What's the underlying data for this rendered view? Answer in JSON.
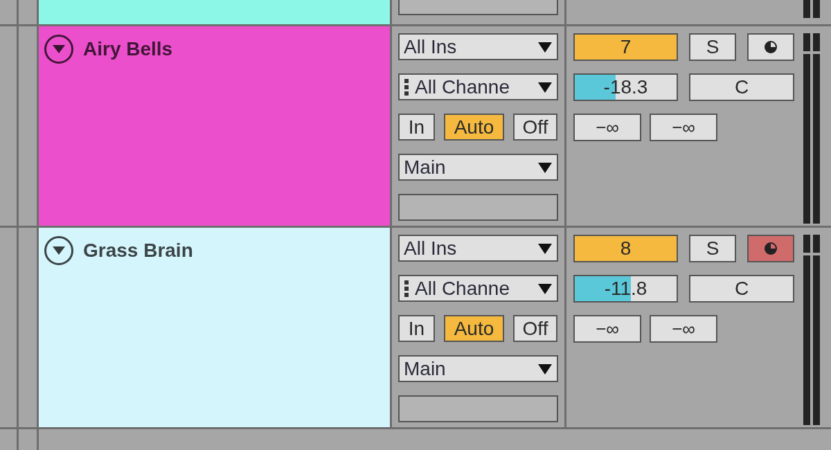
{
  "previous_track": {
    "color": "#8cf7e6"
  },
  "tracks": [
    {
      "name": "Airy Bells",
      "color": "#ec4fcb",
      "input_type": "All Ins",
      "input_channel": "All Channe",
      "monitor": [
        {
          "label": "In",
          "selected": false
        },
        {
          "label": "Auto",
          "selected": true
        },
        {
          "label": "Off",
          "selected": false
        }
      ],
      "output": "Main",
      "number": "7",
      "active": true,
      "solo": "S",
      "soloed": false,
      "armed": false,
      "volume": {
        "reading": "-18.3",
        "level": 0.4
      },
      "pan": "C",
      "sends": [
        "−∞",
        "−∞"
      ]
    },
    {
      "name": "Grass Brain",
      "color": "#d4f5fb",
      "input_type": "All Ins",
      "input_channel": "All Channe",
      "monitor": [
        {
          "label": "In",
          "selected": false
        },
        {
          "label": "Auto",
          "selected": true
        },
        {
          "label": "Off",
          "selected": false
        }
      ],
      "output": "Main",
      "number": "8",
      "active": true,
      "solo": "S",
      "soloed": false,
      "armed": true,
      "volume": {
        "reading": "-11.8",
        "level": 0.55
      },
      "pan": "C",
      "sends": [
        "−∞",
        "−∞"
      ]
    }
  ]
}
